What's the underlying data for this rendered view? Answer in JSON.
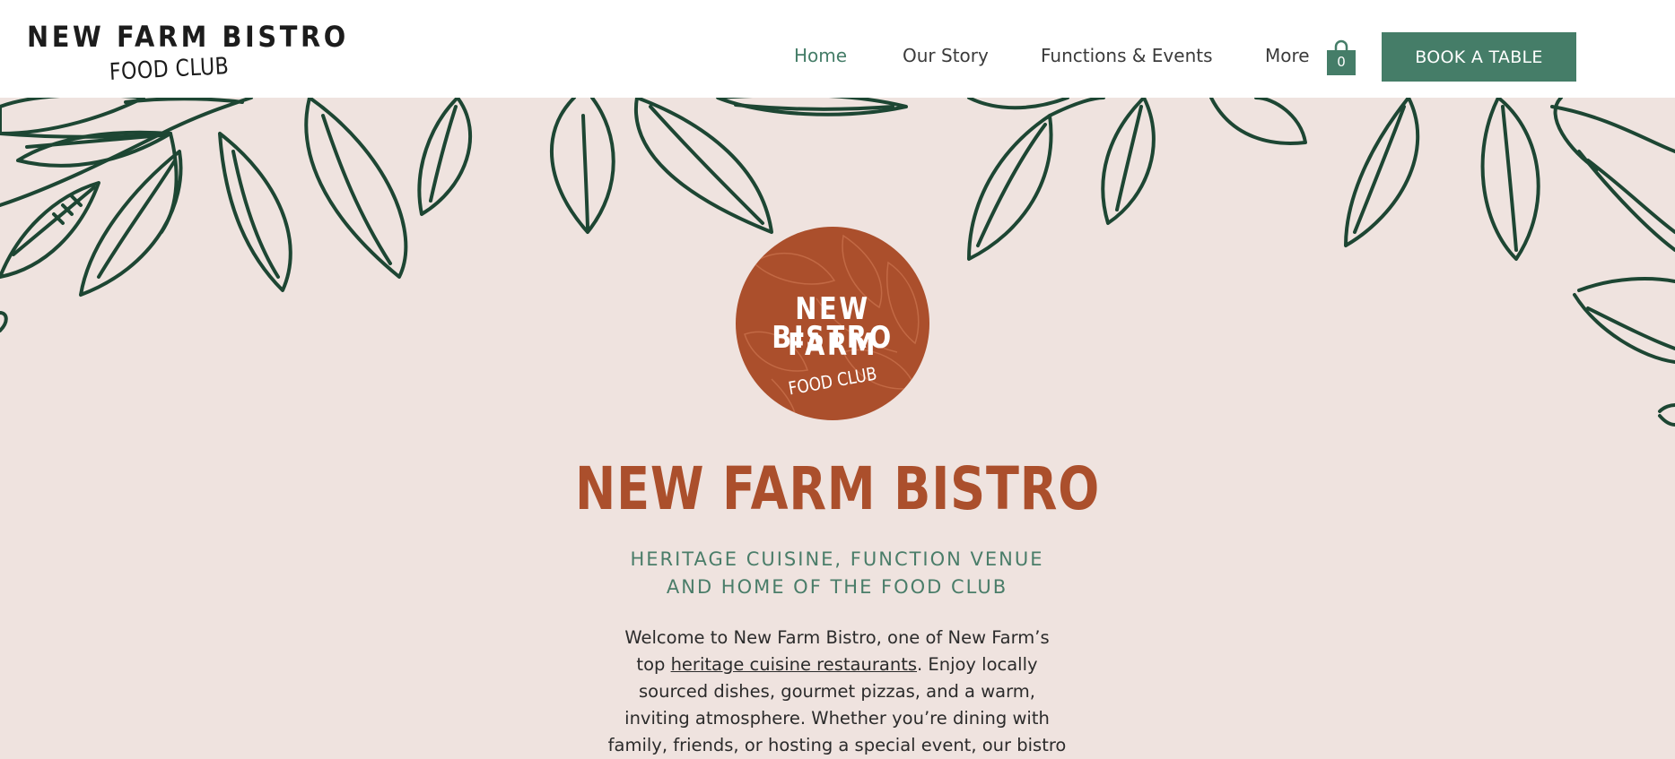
{
  "header": {
    "brand_line1": "NEW FARM BISTRO",
    "brand_line2": "FOOD CLUB",
    "nav": [
      {
        "label": "Home",
        "active": true
      },
      {
        "label": "Our Story",
        "active": false
      },
      {
        "label": "Functions & Events",
        "active": false
      },
      {
        "label": "More",
        "active": false
      }
    ],
    "cart_count": "0",
    "cta_label": "BOOK A TABLE"
  },
  "hero": {
    "badge_line1": "NEW FARM",
    "badge_line2": "BISTRO",
    "badge_sub": "FOOD CLUB",
    "title": "NEW FARM BISTRO",
    "subtitle_line1": "HERITAGE CUISINE, FUNCTION VENUE",
    "subtitle_line2": "AND HOME OF THE FOOD CLUB",
    "intro": {
      "line1": "Welcome to New Farm Bistro, one of New Farm’s",
      "line2_pre": "top ",
      "line2_link": "heritage cuisine restaurants",
      "line2_post": ". Enjoy locally",
      "line3": "sourced dishes, gourmet pizzas, and a warm,",
      "line4": "inviting atmosphere. Whether you’re dining with",
      "line5": "family, friends, or hosting a special event, our bistro"
    }
  },
  "colors": {
    "accent_green": "#457d68",
    "brand_rust": "#ab4f2c",
    "background": "#efe3df",
    "leaf_outline": "#1d4633"
  },
  "icons": {
    "cart": "shopping-bag-icon",
    "leaves": "leaf-illustration"
  }
}
